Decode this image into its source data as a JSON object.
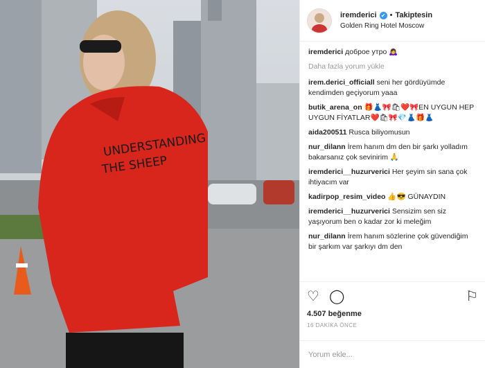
{
  "post": {
    "username": "iremderici",
    "verified_mark": "✔",
    "dot": "•",
    "follow_state": "Takiptesin",
    "location": "Golden Ring Hotel Moscow",
    "caption_user": "iremderici",
    "caption_text": "доброе утро 🙇‍♀️",
    "load_more": "Daha fazla yorum yükle",
    "likes": "4.507 beğenme",
    "time": "16 DAKİKA ÖNCE",
    "add_comment_placeholder": "Yorum ekle..."
  },
  "comments": [
    {
      "user": "irem.derici_officiall",
      "text": "seni her gördüyümde kendimden geçiyorum yaaa"
    },
    {
      "user": "butik_arena_on",
      "text": "🎁👗🎀🛍❤️🎀EN UYGUN HEP UYGUN FİYATLAR❤️🛍🎀💎👗🎁👗"
    },
    {
      "user": "aida200511",
      "text": "Rusca biliyomusun"
    },
    {
      "user": "nur_dilann",
      "text": "İrem hanım dm den bir şarkı yolladım bakarsanız çok sevinirim 🙏"
    },
    {
      "user": "iremderici__huzurverici",
      "text": "Her şeyim sin sana çok ihtiyacım var"
    },
    {
      "user": "kadirpop_resim_video",
      "text": "👍😎 GÜNAYDIN"
    },
    {
      "user": "iremderici__huzurverici",
      "text": "Sensizim sen siz yaşıyorum ben o kadar zor ki meleğim"
    },
    {
      "user": "nur_dilann",
      "text": "İrem hanım sözlerine çok güvendiğim bir şarkım var şarkıyı dm den"
    }
  ],
  "icons": {
    "like": "heart-icon",
    "comment": "comment-icon",
    "save": "bookmark-icon"
  },
  "colors": {
    "jacket": "#d8261c",
    "verified": "#3897f0",
    "muted": "#999999"
  }
}
